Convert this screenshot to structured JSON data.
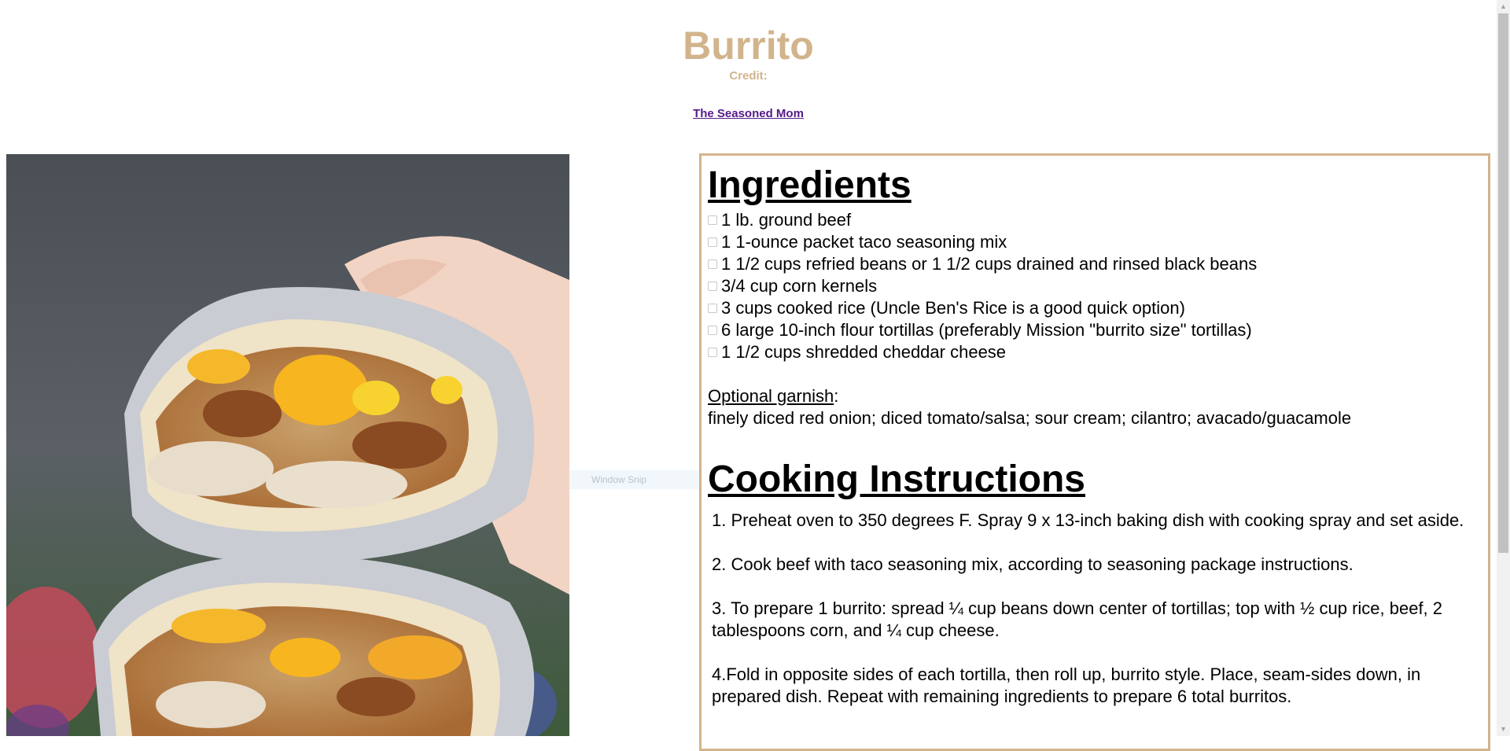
{
  "recipe": {
    "title": "Burrito",
    "credit_label": "Credit:",
    "source_link": "The Seasoned Mom"
  },
  "ingredients": {
    "heading": "Ingredients",
    "items": [
      "1 lb. ground beef",
      "1 1-ounce packet taco seasoning mix",
      "1 1/2 cups refried beans or 1 1/2 cups drained and rinsed black beans",
      "3/4 cup corn kernels",
      "3 cups cooked rice (Uncle Ben's Rice is a good quick option)",
      "6 large 10-inch flour tortillas (preferably Mission \"burrito size\" tortillas)",
      "1 1/2 cups shredded cheddar cheese"
    ],
    "garnish_label": "Optional garnish",
    "garnish_colon": ":",
    "garnish_text": "finely diced red onion; diced tomato/salsa; sour cream; cilantro; avacado/guacamole"
  },
  "instructions": {
    "heading": "Cooking Instructions",
    "steps": [
      "1. Preheat oven to 350 degrees F. Spray 9 x 13-inch baking dish with cooking spray and set aside.",
      "2. Cook beef with taco seasoning mix, according to seasoning package instructions.",
      "3. To prepare 1 burrito: spread ¼ cup beans down center of tortillas; top with ½ cup rice, beef, 2 tablespoons corn, and ¼ cup cheese.",
      "4.Fold in opposite sides of each tortilla, then roll up, burrito style. Place, seam-sides down, in prepared dish. Repeat with remaining ingredients to prepare 6 total burritos."
    ]
  },
  "overlay": {
    "snip_hint": "Window Snip"
  },
  "colors": {
    "accent_tan": "#d2b48c",
    "link_visited": "#551a8b"
  }
}
